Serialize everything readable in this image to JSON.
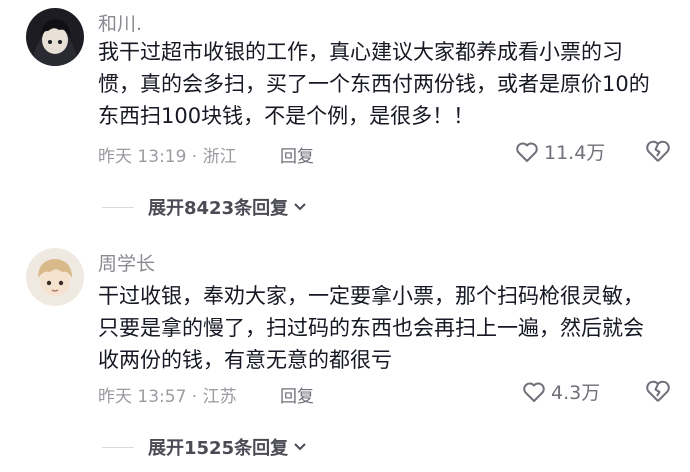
{
  "comments": [
    {
      "username": "和川.",
      "text": "我干过超市收银的工作，真心建议大家都养成看小票的习惯，真的会多扫，买了一个东西付两份钱，或者是原价10的东西扫100块钱，不是个例，是很多！！",
      "meta": "昨天 13:19 · 浙江",
      "reply_label": "回复",
      "likes": "11.4万",
      "expand_label": "展开8423条回复",
      "avatar": "dark-haired-cartoon-avatar"
    },
    {
      "username": "周学长",
      "text": "干过收银，奉劝大家，一定要拿小票，那个扫码枪很灵敏，只要是拿的慢了，扫过码的东西也会再扫上一遍，然后就会收两份的钱，有意无意的都很亏",
      "meta": "昨天 13:57 · 江苏",
      "reply_label": "回复",
      "likes": "4.3万",
      "expand_label": "展开1525条回复",
      "avatar": "blond-chibi-avatar"
    }
  ],
  "icons": {
    "like": "heart-outline-icon",
    "dislike": "broken-heart-icon",
    "expand": "chevron-down-icon"
  },
  "colors": {
    "text": "#161823",
    "secondary": "#8a8b91",
    "icon": "#6f7079"
  }
}
